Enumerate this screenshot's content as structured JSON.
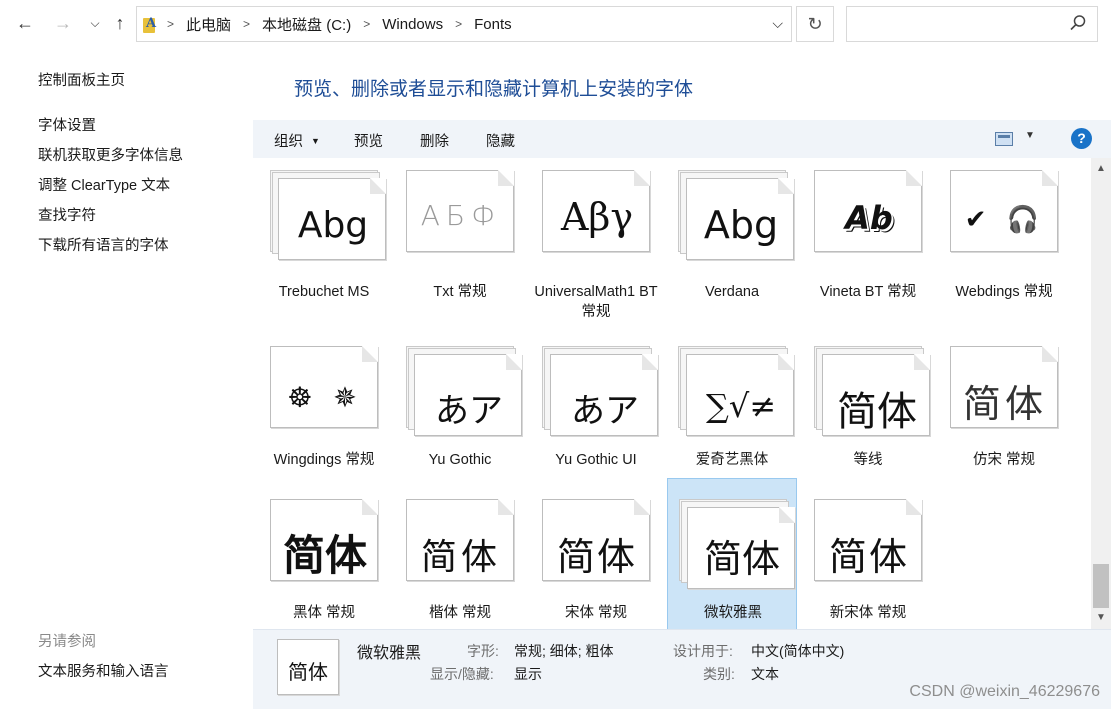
{
  "address_bar": {
    "breadcrumbs": [
      "此电脑",
      "本地磁盘 (C:)",
      "Windows",
      "Fonts"
    ],
    "search_placeholder": ""
  },
  "left_pane": {
    "links": [
      "控制面板主页",
      "字体设置",
      "联机获取更多字体信息",
      "调整 ClearType 文本",
      "查找字符",
      "下载所有语言的字体"
    ],
    "see_also_title": "另请参阅",
    "see_also_links": [
      "文本服务和输入语言"
    ]
  },
  "main": {
    "heading": "预览、删除或者显示和隐藏计算机上安装的字体"
  },
  "toolbar": {
    "organize": "组织",
    "preview": "预览",
    "delete": "删除",
    "hide": "隐藏",
    "help": "?"
  },
  "fonts": [
    {
      "preview": "Abg",
      "label": "Trebuchet MS",
      "stacked": true
    },
    {
      "preview": "АБФ",
      "label": "Txt 常规",
      "stacked": false
    },
    {
      "preview": "Αβγ",
      "label": "UniversalMath1 BT 常规",
      "stacked": false
    },
    {
      "preview": "Abg",
      "label": "Verdana",
      "stacked": true
    },
    {
      "preview": "Ab",
      "label": "Vineta BT 常规",
      "stacked": false
    },
    {
      "preview": "✔ 🎧",
      "label": "Webdings 常规",
      "stacked": false
    },
    {
      "preview": "☸ ✵",
      "label": "Wingdings 常规",
      "stacked": false
    },
    {
      "preview": "あア",
      "label": "Yu Gothic",
      "stacked": true
    },
    {
      "preview": "あア",
      "label": "Yu Gothic UI",
      "stacked": true
    },
    {
      "preview": "∑√≠",
      "label": "爱奇艺黑体",
      "stacked": true
    },
    {
      "preview": "简体",
      "label": "等线",
      "stacked": true
    },
    {
      "preview": "简体",
      "label": "仿宋 常规",
      "stacked": false
    },
    {
      "preview": "简体",
      "label": "黑体 常规",
      "stacked": false
    },
    {
      "preview": "简体",
      "label": "楷体 常规",
      "stacked": false
    },
    {
      "preview": "简体",
      "label": "宋体 常规",
      "stacked": false
    },
    {
      "preview": "简体",
      "label": "微软雅黑",
      "stacked": true,
      "selected": true
    },
    {
      "preview": "简体",
      "label": "新宋体 常规",
      "stacked": false
    }
  ],
  "details": {
    "thumb": "简体",
    "name": "微软雅黑",
    "style_label": "字形:",
    "style_value": "常规; 细体; 粗体",
    "show_label": "显示/隐藏:",
    "show_value": "显示",
    "designed_label": "设计用于:",
    "designed_value": "中文(简体中文)",
    "category_label": "类别:",
    "category_value": "文本"
  },
  "watermark": "CSDN @weixin_46229676",
  "colors": {
    "heading": "#1e4d96",
    "toolbar_bg": "#f0f4f9",
    "selection_bg": "#cce4f7",
    "selection_border": "#99c9ef",
    "help": "#1a73c8"
  },
  "icons": [
    "back-arrow-icon",
    "forward-arrow-icon",
    "recent-dropdown-icon",
    "up-arrow-icon",
    "folder-icon",
    "refresh-icon",
    "search-icon",
    "view-icon",
    "help-icon"
  ]
}
